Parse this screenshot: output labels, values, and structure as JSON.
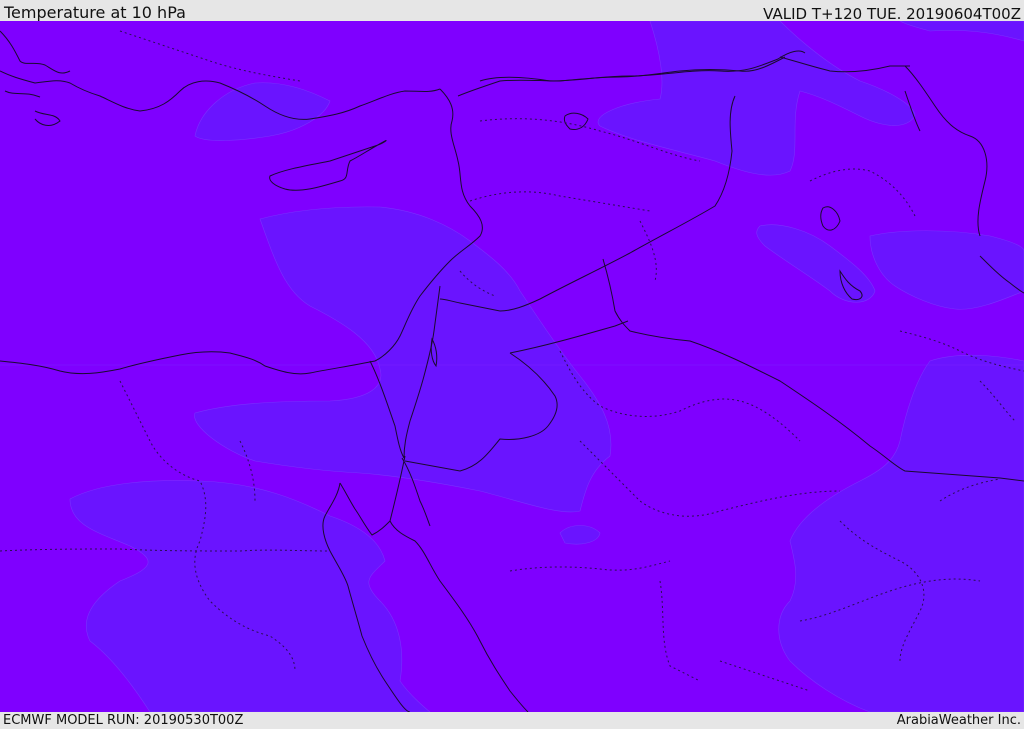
{
  "header": {
    "title": "Temperature at 10 hPa",
    "valid_time": "VALID T+120 TUE. 20190604T00Z"
  },
  "footer": {
    "model_run": "ECMWF MODEL RUN: 20190530T00Z",
    "credit": "ArabiaWeather Inc."
  },
  "map": {
    "field": "temperature",
    "level": "10 hPa",
    "colors": {
      "background_band": "#7f00ff",
      "colder_band": "#6a14ff",
      "coastline": "#1b0a30"
    }
  }
}
